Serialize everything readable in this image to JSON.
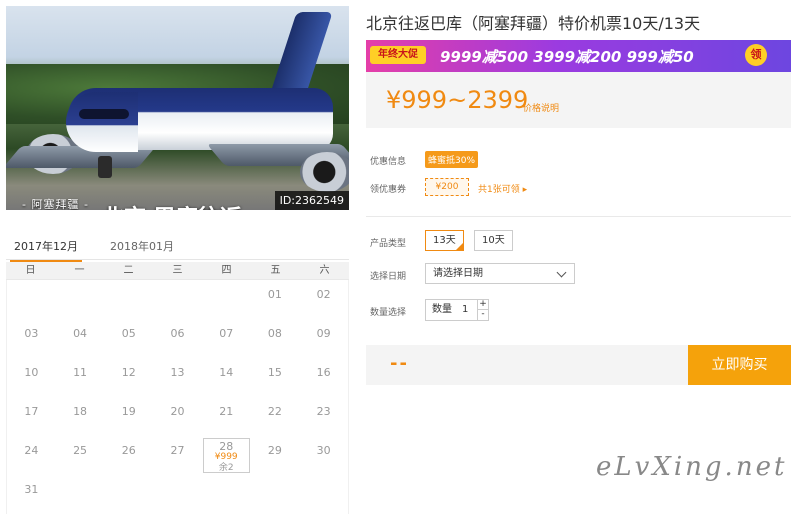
{
  "product": {
    "title": "北京往返巴库（阿塞拜疆）特价机票10天/13天",
    "price_range": "¥999~2399",
    "price_note": "价格说明"
  },
  "hero": {
    "caption": "- 阿塞拜疆 -",
    "overlay": "北京  巴库往返",
    "id_tag": "ID:2362549"
  },
  "banner": {
    "tag": "年终大促",
    "deals": "9999减500  3999减200  999减50",
    "coin": "领"
  },
  "promotions": {
    "label": "优惠信息",
    "badge": "蜂蜜抵30%"
  },
  "coupon": {
    "label": "领优惠券",
    "value": "¥200",
    "link": "共1张可领 ▸"
  },
  "options": {
    "type_label": "产品类型",
    "types": [
      "13天",
      "10天"
    ],
    "date_label": "选择日期",
    "date_placeholder": "请选择日期",
    "qty_label": "数量选择",
    "qty_text": "数量",
    "qty_value": "1",
    "qty_up": "+",
    "qty_down": "-"
  },
  "buy": {
    "dash": "--",
    "button": "立即购买"
  },
  "calendar": {
    "tabs": [
      "2017年12月",
      "2018年01月"
    ],
    "weekdays": [
      "日",
      "一",
      "二",
      "三",
      "四",
      "五",
      "六"
    ],
    "special_price": "¥999",
    "special_remain": "余2"
  },
  "watermark": "eLvXing.net",
  "colors": {
    "accent": "#f08a12",
    "buy": "#f5a20b"
  }
}
